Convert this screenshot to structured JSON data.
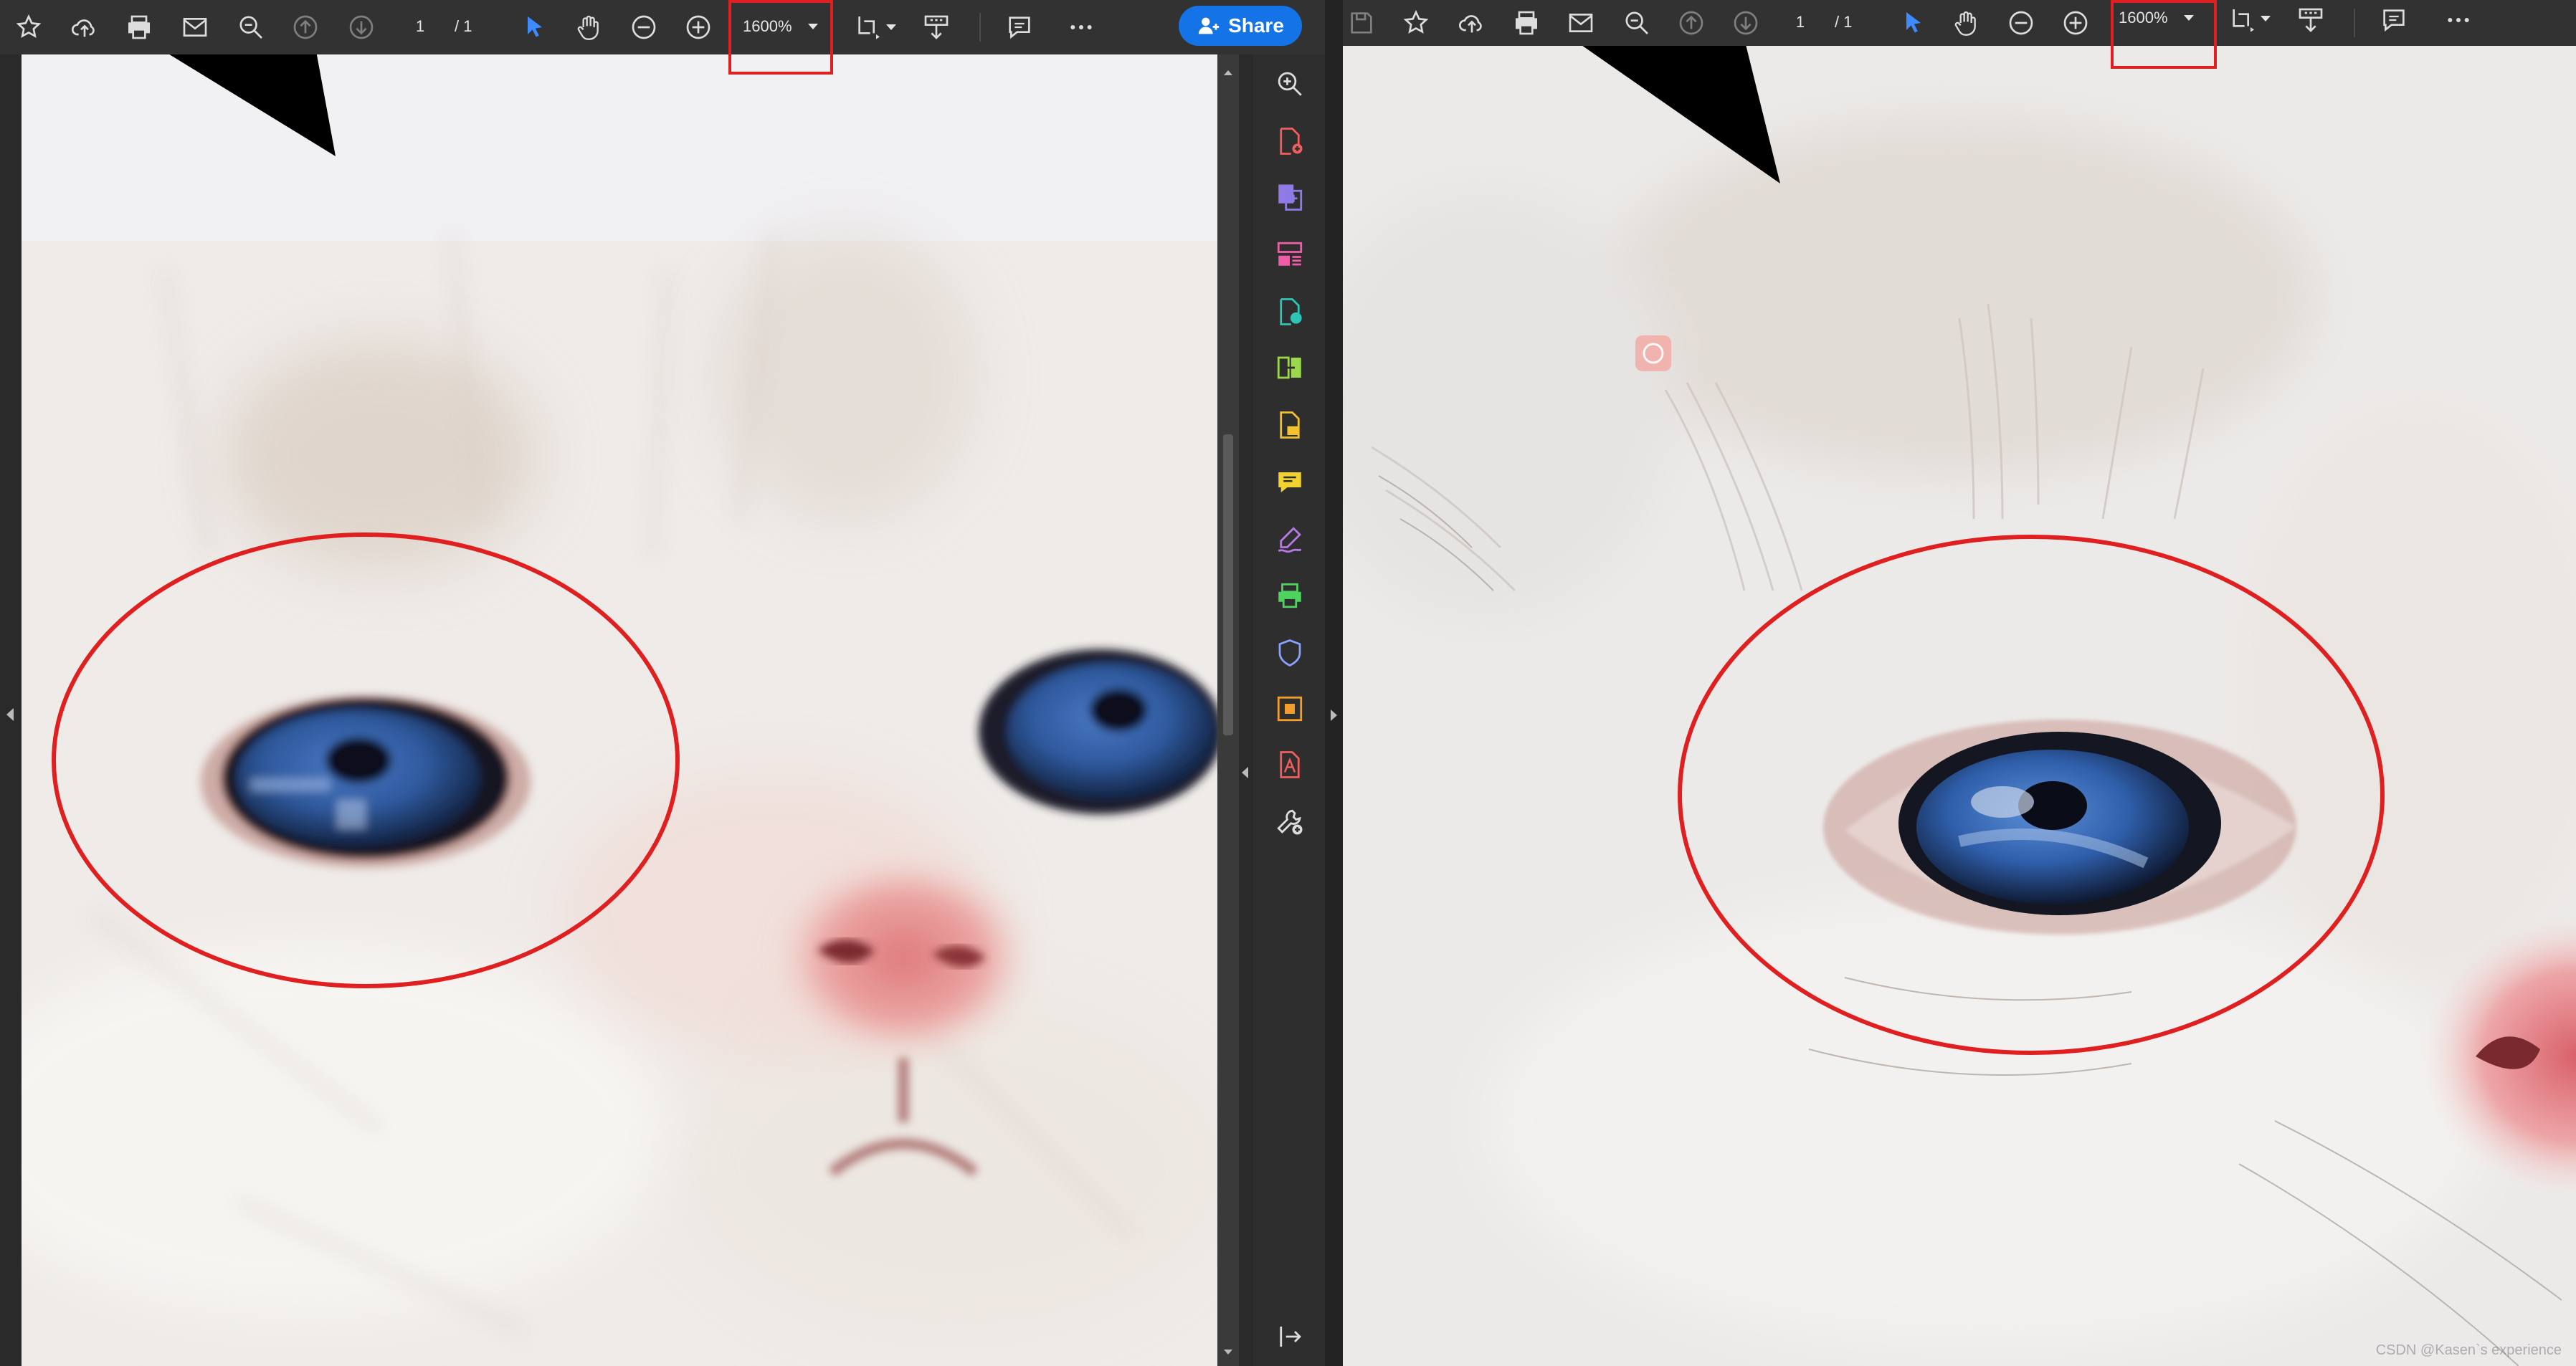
{
  "left_window": {
    "page": {
      "current": "1",
      "total": "/ 1"
    },
    "zoom": "1600%",
    "share_label": "Share"
  },
  "right_window": {
    "page": {
      "current": "1",
      "total": "/ 1"
    },
    "zoom": "1600%"
  },
  "toolbar_icons": [
    "star-icon",
    "cloud-upload-icon",
    "print-icon",
    "mail-icon",
    "zoom-out-search-icon",
    "page-up-icon",
    "page-down-icon",
    "select-cursor-icon",
    "hand-icon",
    "zoom-minus-icon",
    "zoom-plus-icon",
    "fit-page-icon",
    "scroll-mode-icon",
    "comment-icon",
    "more-icon"
  ],
  "tools_pane_icons": [
    "zoom-tool-icon",
    "create-pdf-icon",
    "export-pdf-icon",
    "organize-pages-icon",
    "edit-pdf-icon",
    "combine-files-icon",
    "scan-ocr-icon",
    "comment-tool-icon",
    "fill-sign-icon",
    "print-production-icon",
    "protect-icon",
    "optimize-icon",
    "acrobat-sign-icon",
    "more-tools-icon"
  ],
  "watermark": "CSDN @Kasen`s experience",
  "colors": {
    "toolbar_bg": "#323232",
    "accent": "#1473e6",
    "annotation_red": "#e02020"
  }
}
